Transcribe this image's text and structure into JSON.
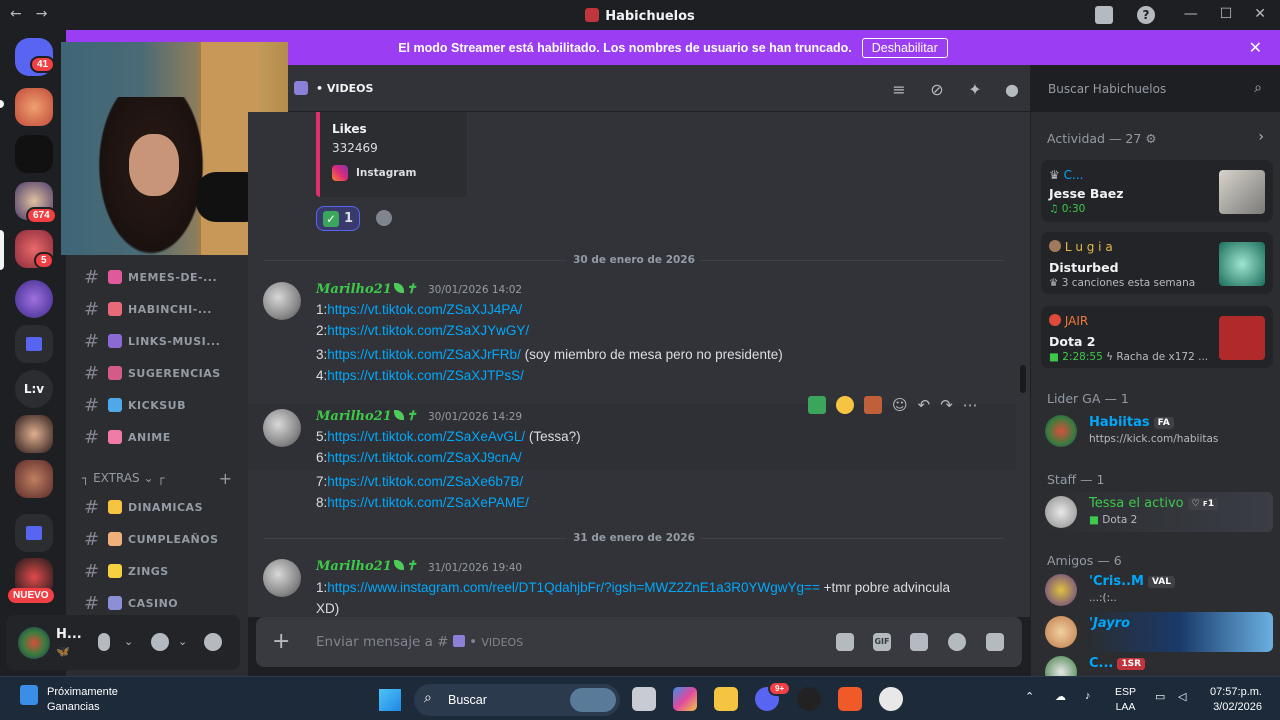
{
  "window": {
    "title": "Habichuelos",
    "nav_back": "←",
    "nav_fwd": "→",
    "minimize": "—",
    "maximize": "☐",
    "close": "✕"
  },
  "streamer": {
    "message": "El modo Streamer está habilitado. Los nombres de usuario se han truncado.",
    "button": "Deshabilitar",
    "close": "✕"
  },
  "servers": {
    "badges": [
      "41",
      "674",
      "5"
    ],
    "text_server": "L:v",
    "nuevo": "NUEVO"
  },
  "sidebar": {
    "channels": [
      {
        "name": "MEMES-DE-...",
        "color": "#e05a9b"
      },
      {
        "name": "HABINCHI-...",
        "color": "#e86a7a"
      },
      {
        "name": "LINKS-MUSI...",
        "color": "#8b6ad6"
      },
      {
        "name": "SUGERENCIAS",
        "color": "#d45a8a"
      },
      {
        "name": "KICKSUB",
        "color": "#4fa8e8"
      },
      {
        "name": "ANIME",
        "color": "#f07aa8"
      }
    ],
    "category": "EXTRAS",
    "category_prefix": "┐",
    "category_suffix": "┌",
    "extras": [
      {
        "name": "DINAMICAS",
        "color": "#f5c542"
      },
      {
        "name": "CUMPLEAÑOS",
        "color": "#f0b07a"
      },
      {
        "name": "ZINGS",
        "color": "#f5d142"
      },
      {
        "name": "CASINO",
        "color": "#8c8fd6"
      }
    ]
  },
  "user": {
    "name": "H...",
    "status": "🦋"
  },
  "channel_header": {
    "name": "VIDEOS",
    "dot": "•"
  },
  "chat": {
    "embed": {
      "label": "Likes",
      "value": "332469",
      "source": "Instagram"
    },
    "reaction_count": "1",
    "dates": [
      "30 de enero de 2026",
      "31 de enero de 2026"
    ],
    "messages": [
      {
        "author": "Marilho21",
        "timestamp": "30/01/2026 14:02",
        "lines": [
          {
            "prefix": "1:",
            "link": "https://vt.tiktok.com/ZSaXJJ4PA/",
            "suffix": ""
          },
          {
            "prefix": "2:",
            "link": "https://vt.tiktok.com/ZSaXJYwGY/",
            "suffix": ""
          },
          {
            "prefix": "3:",
            "link": "https://vt.tiktok.com/ZSaXJrFRb/",
            "suffix": " (soy miembro de mesa pero no presidente)"
          },
          {
            "prefix": "4:",
            "link": "https://vt.tiktok.com/ZSaXJTPsS/",
            "suffix": ""
          }
        ]
      },
      {
        "author": "Marilho21",
        "timestamp": "30/01/2026 14:29",
        "lines": [
          {
            "prefix": "5:",
            "link": "https://vt.tiktok.com/ZSaXeAvGL/",
            "suffix": " (Tessa?)"
          },
          {
            "prefix": "6:",
            "link": "https://vt.tiktok.com/ZSaXJ9cnA/",
            "suffix": ""
          },
          {
            "prefix": "7:",
            "link": "https://vt.tiktok.com/ZSaXe6b7B/",
            "suffix": ""
          },
          {
            "prefix": "8:",
            "link": "https://vt.tiktok.com/ZSaXePAME/",
            "suffix": ""
          }
        ]
      },
      {
        "author": "Marilho21",
        "timestamp": "31/01/2026 19:40",
        "lines": [
          {
            "prefix": "1:",
            "link": "https://www.instagram.com/reel/DT1QdahjbFr/?igsh=MWZ2ZnE1a3R0YWgwYg==",
            "suffix": " +tmr pobre advincula"
          },
          {
            "prefix": "",
            "link": "",
            "suffix": "XD)"
          }
        ]
      }
    ]
  },
  "composer": {
    "placeholder": "Enviar mensaje a #",
    "channel": "VIDEOS",
    "dot": "•",
    "gif": "GIF"
  },
  "right": {
    "search_placeholder": "Buscar Habichuelos",
    "activity_header": "Actividad — 27",
    "activities": [
      {
        "user": "C...",
        "game": "Jesse Baez",
        "detail": "♫ 0:30",
        "user_color": "#00a8fc"
      },
      {
        "user": "L u g i a",
        "game": "Disturbed",
        "detail": "3 canciones esta semana",
        "user_color": "#e6b84a"
      },
      {
        "user": "JAIR",
        "game": "Dota 2",
        "detail": "2:28:55",
        "detail2": "Racha de x172 ...",
        "user_color": "#f0783c"
      }
    ],
    "groups": [
      {
        "header": "Lider GA — 1",
        "members": [
          {
            "name": "Habiitas",
            "tag": "FA",
            "status": "https://kick.com/habiitas",
            "color": "#00a8fc"
          }
        ]
      },
      {
        "header": "Staff — 1",
        "members": [
          {
            "name": "Tessa el activo",
            "tag": "♡ ꜰ1",
            "status": "Dota 2",
            "color": "#3ec94a"
          }
        ]
      },
      {
        "header": "Amigos — 6",
        "members": [
          {
            "name": "'Cris..M",
            "tag": "VAL",
            "status": "...:(:..",
            "color": "#00a8fc"
          },
          {
            "name": "'Jayro",
            "tag": "",
            "status": "",
            "color": "#00a8fc"
          },
          {
            "name": "C...",
            "tag": "1SR",
            "status": "",
            "color": "#00a8fc"
          }
        ]
      }
    ]
  },
  "taskbar": {
    "weather_title": "Próximamente",
    "weather_sub": "Ganancias",
    "search": "Buscar",
    "lang1": "ESP",
    "lang2": "LAA",
    "time": "07:57:p.m.",
    "date": "3/02/2026",
    "discord_badge": "9+"
  }
}
